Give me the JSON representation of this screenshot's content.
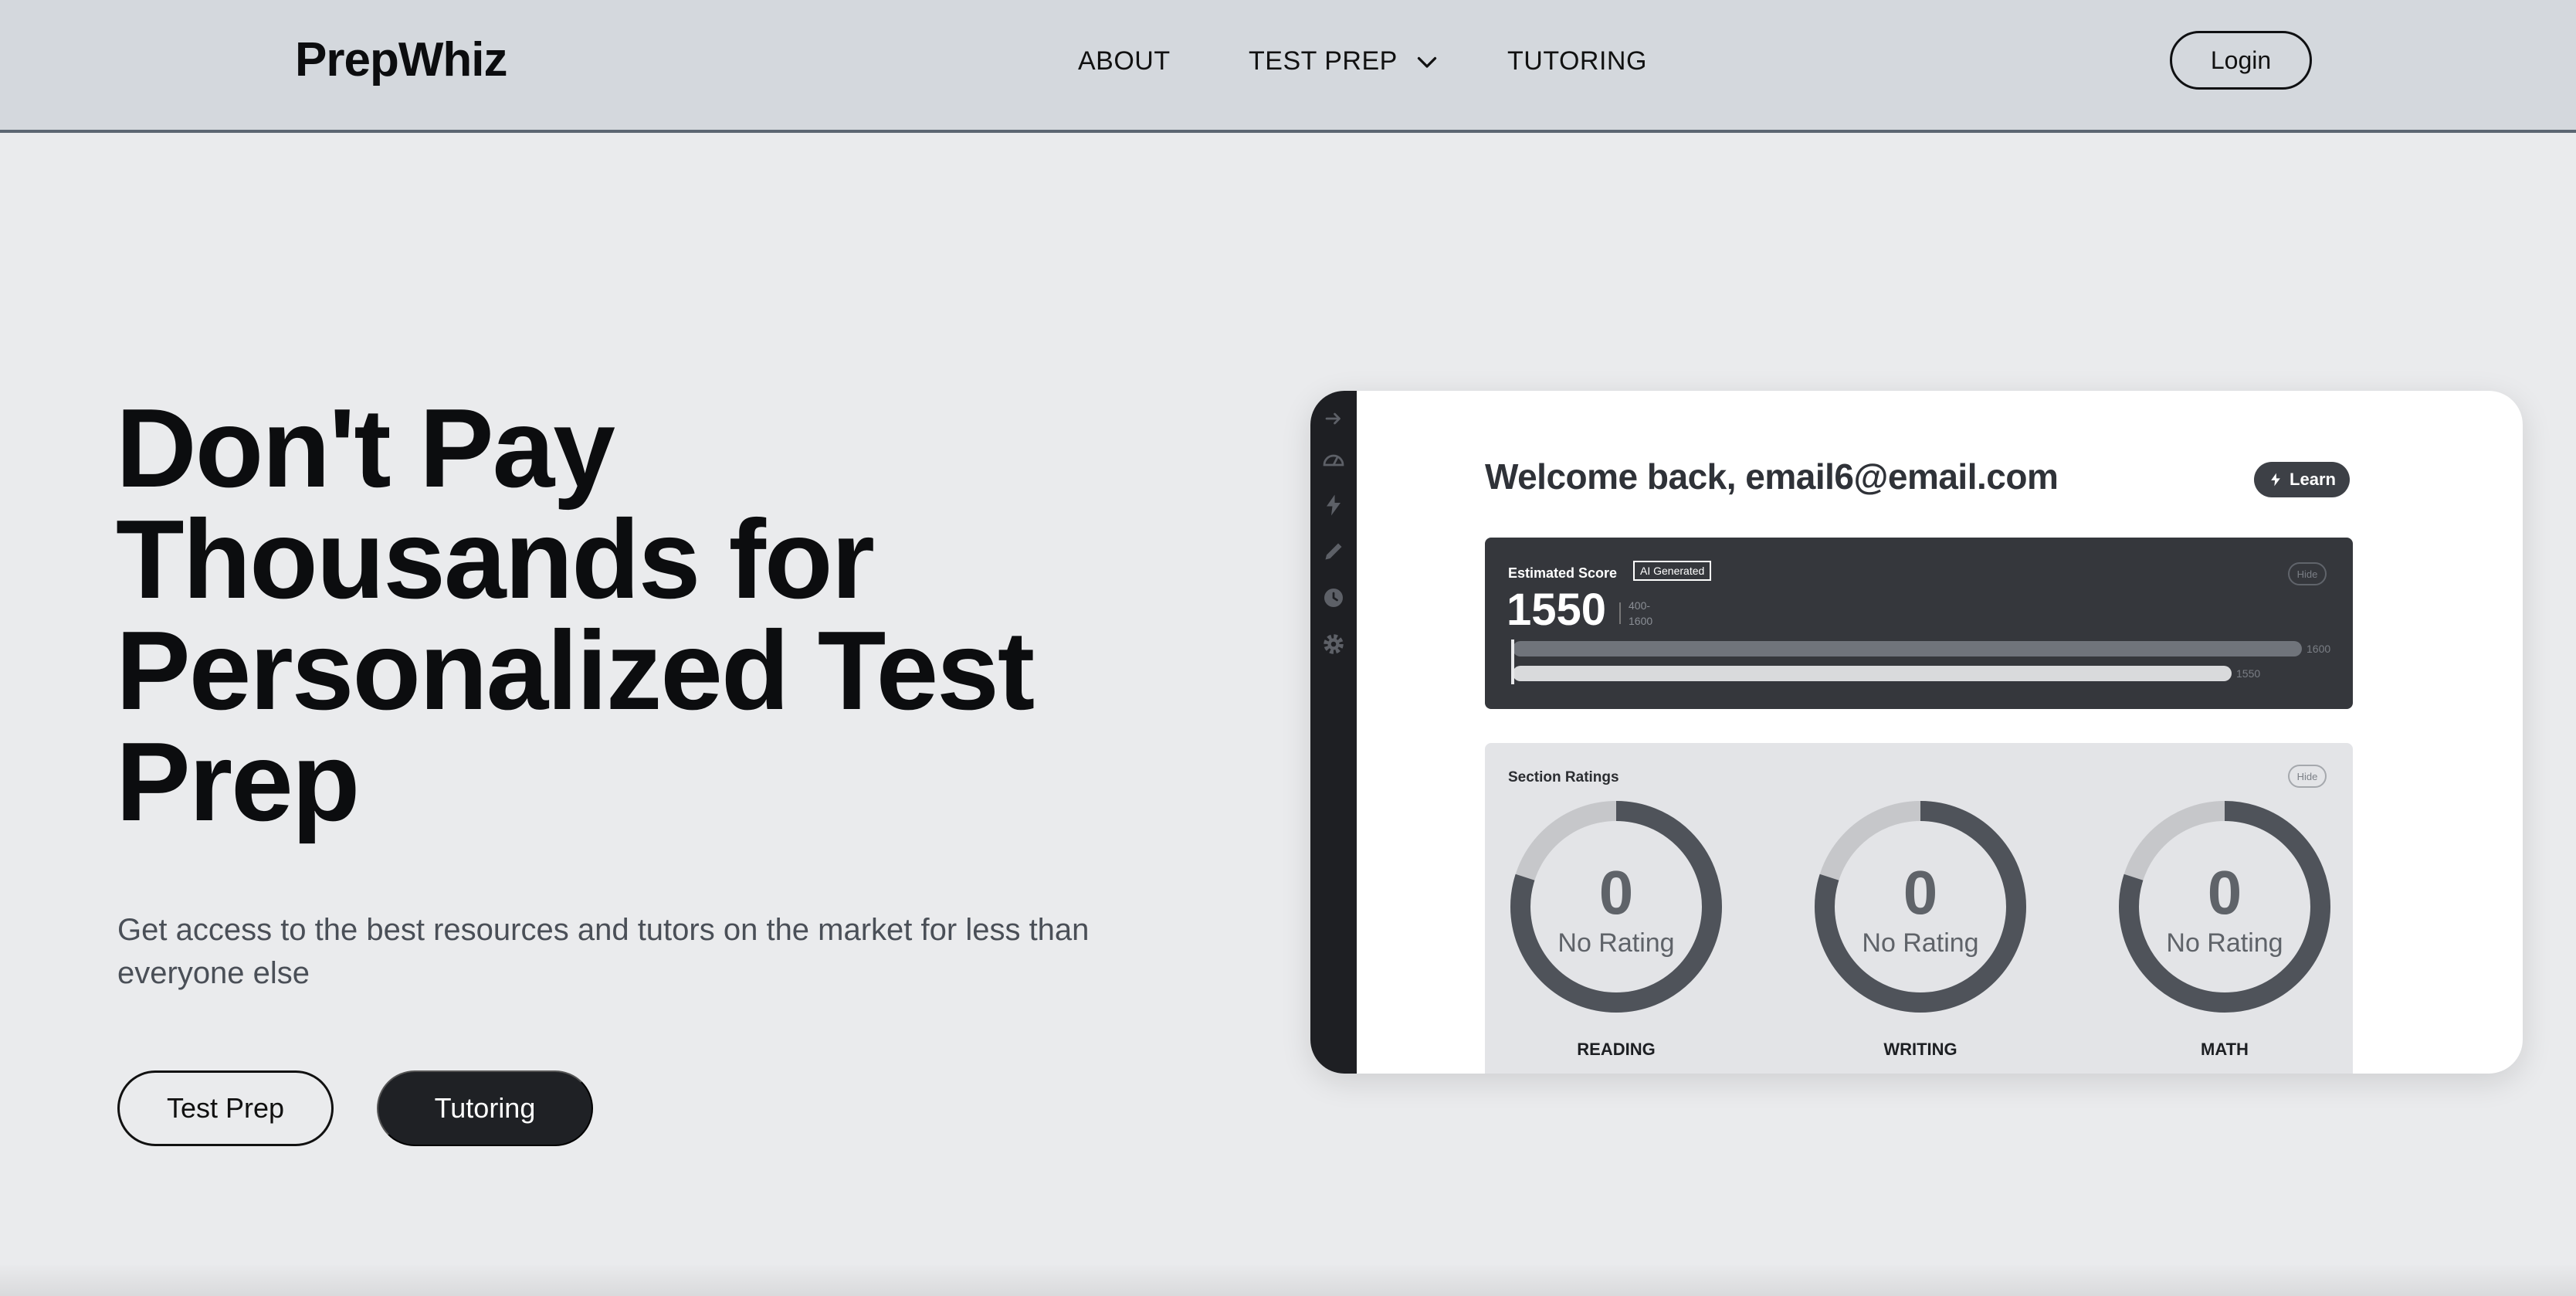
{
  "nav": {
    "logo": "PrepWhiz",
    "links": [
      {
        "label": "ABOUT"
      },
      {
        "label": "TEST PREP"
      },
      {
        "label": "TUTORING"
      }
    ],
    "login_label": "Login"
  },
  "hero": {
    "title": "Don't Pay Thousands for Personalized Test Prep",
    "subtitle": "Get access to the best resources and tutors on the market for less than everyone else",
    "buttons": {
      "test_prep": "Test Prep",
      "tutoring": "Tutoring"
    }
  },
  "preview": {
    "welcome": "Welcome back, email6@email.com",
    "learn_label": "Learn",
    "sidebar_icons": [
      "arrow-right-icon",
      "dashboard-gauge-icon",
      "lightning-icon",
      "pencil-icon",
      "clock-icon",
      "gear-icon"
    ],
    "estimated_score": {
      "label": "Estimated Score",
      "badge": "AI Generated",
      "hide_label": "Hide",
      "score": "1550",
      "range_low": "400-",
      "range_high": "1600",
      "max_bar_label": "1600",
      "score_bar_label": "1550",
      "score_value": 1550,
      "max_value": 1600
    },
    "section_ratings": {
      "title": "Section Ratings",
      "hide_label": "Hide",
      "sections": [
        {
          "name": "READING",
          "value": "0",
          "status": "No Rating"
        },
        {
          "name": "WRITING",
          "value": "0",
          "status": "No Rating"
        },
        {
          "name": "MATH",
          "value": "0",
          "status": "No Rating"
        }
      ]
    }
  },
  "colors": {
    "nav_bg": "#d4d8dd",
    "page_bg": "#eaebed",
    "dark_button": "#1f2125",
    "score_panel": "#35373c",
    "ring": "#4f535a"
  }
}
